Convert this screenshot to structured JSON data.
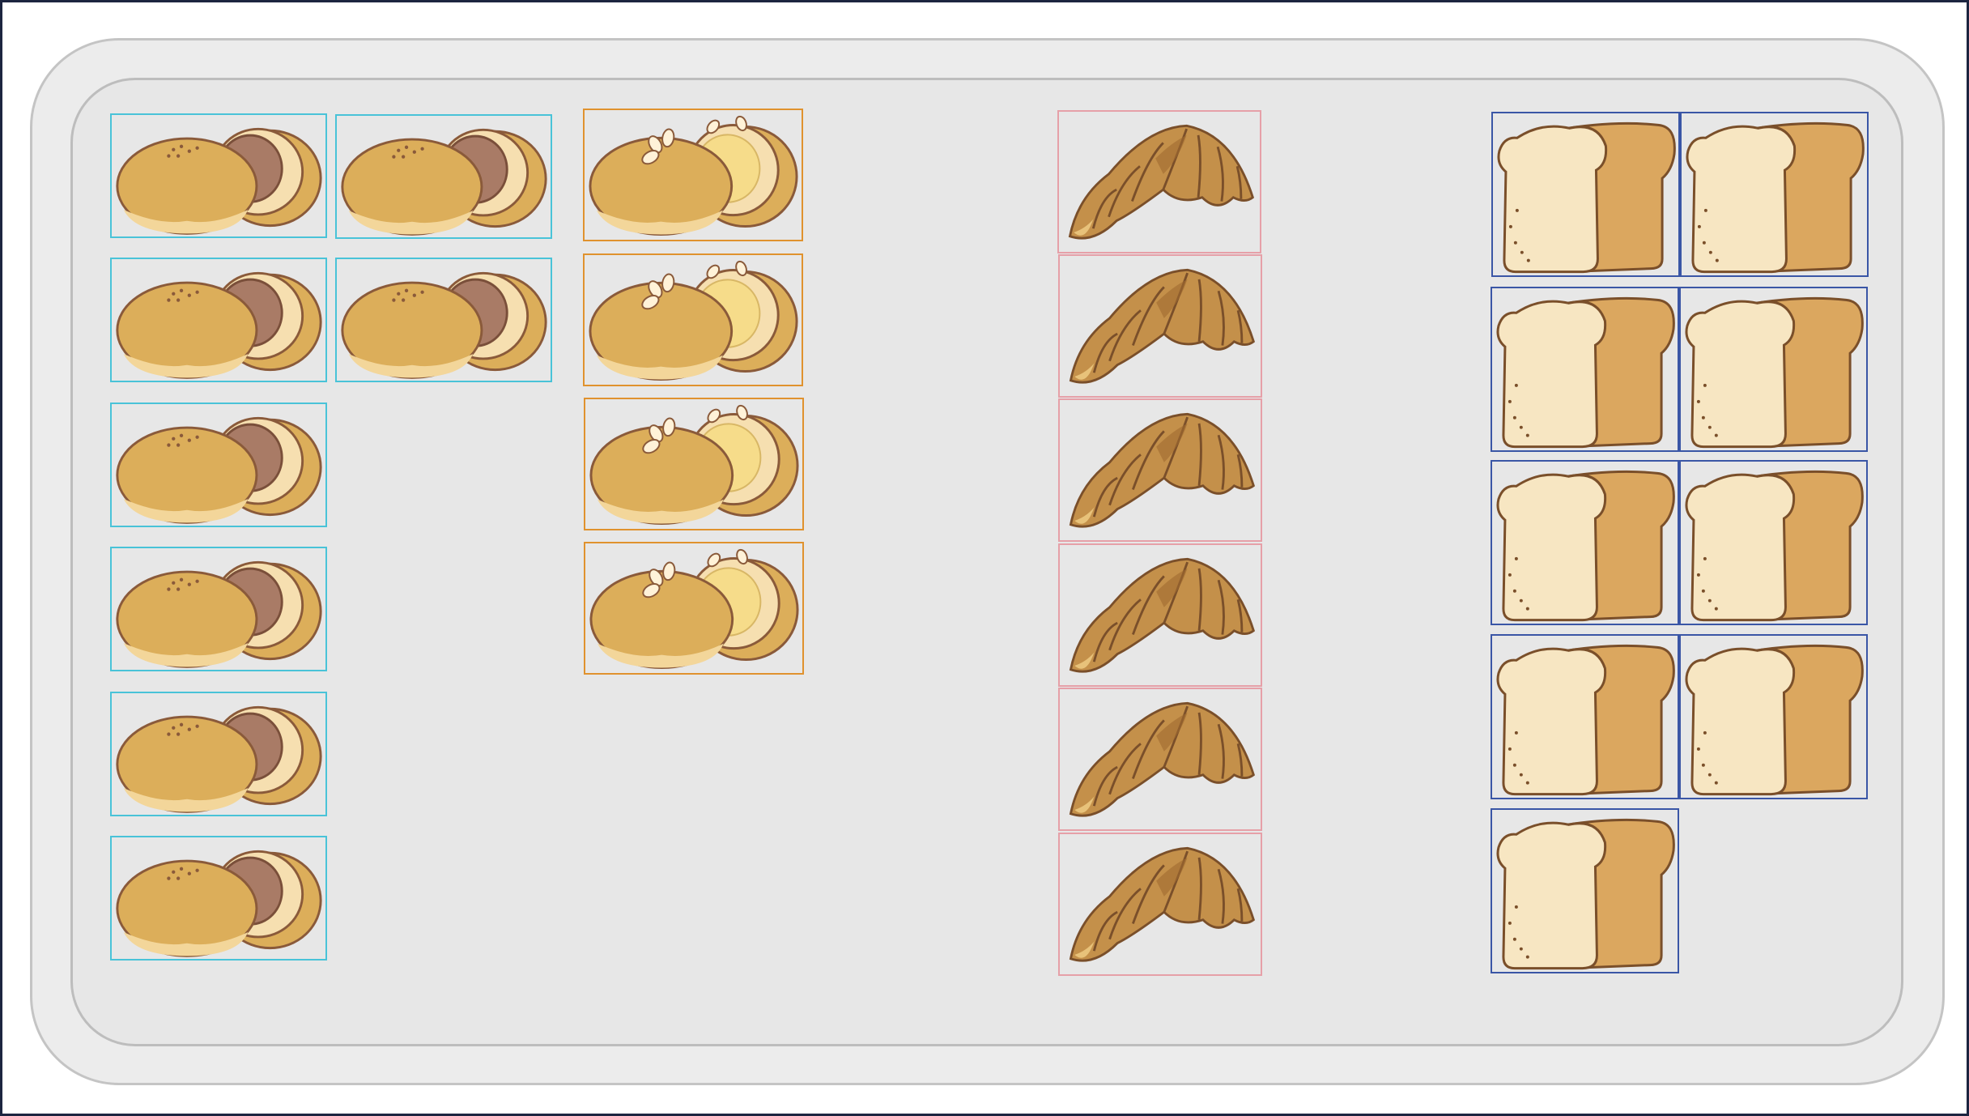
{
  "tray": {
    "groups": [
      {
        "name": "bean-paste-buns",
        "icon": "bean-paste-bun-icon",
        "count": 8,
        "outline_color": "#49c3d8"
      },
      {
        "name": "cream-buns",
        "icon": "cream-bun-icon",
        "count": 4,
        "outline_color": "#e0922e"
      },
      {
        "name": "croissants",
        "icon": "croissant-icon",
        "count": 6,
        "outline_color": "#e6a0a8"
      },
      {
        "name": "bread-loaves",
        "icon": "bread-loaf-icon",
        "count": 9,
        "outline_color": "#3a56a6"
      }
    ]
  },
  "colors": {
    "page_border": "#1c2540",
    "tray_fill": "#e7e7e7",
    "bun_crust": "#dcae5a",
    "bean_paste": "#a97b66",
    "custard": "#f6dc8a",
    "croissant": "#bf8a3e",
    "bread_crumb": "#f7e6c2",
    "bread_crust": "#dba75f"
  }
}
